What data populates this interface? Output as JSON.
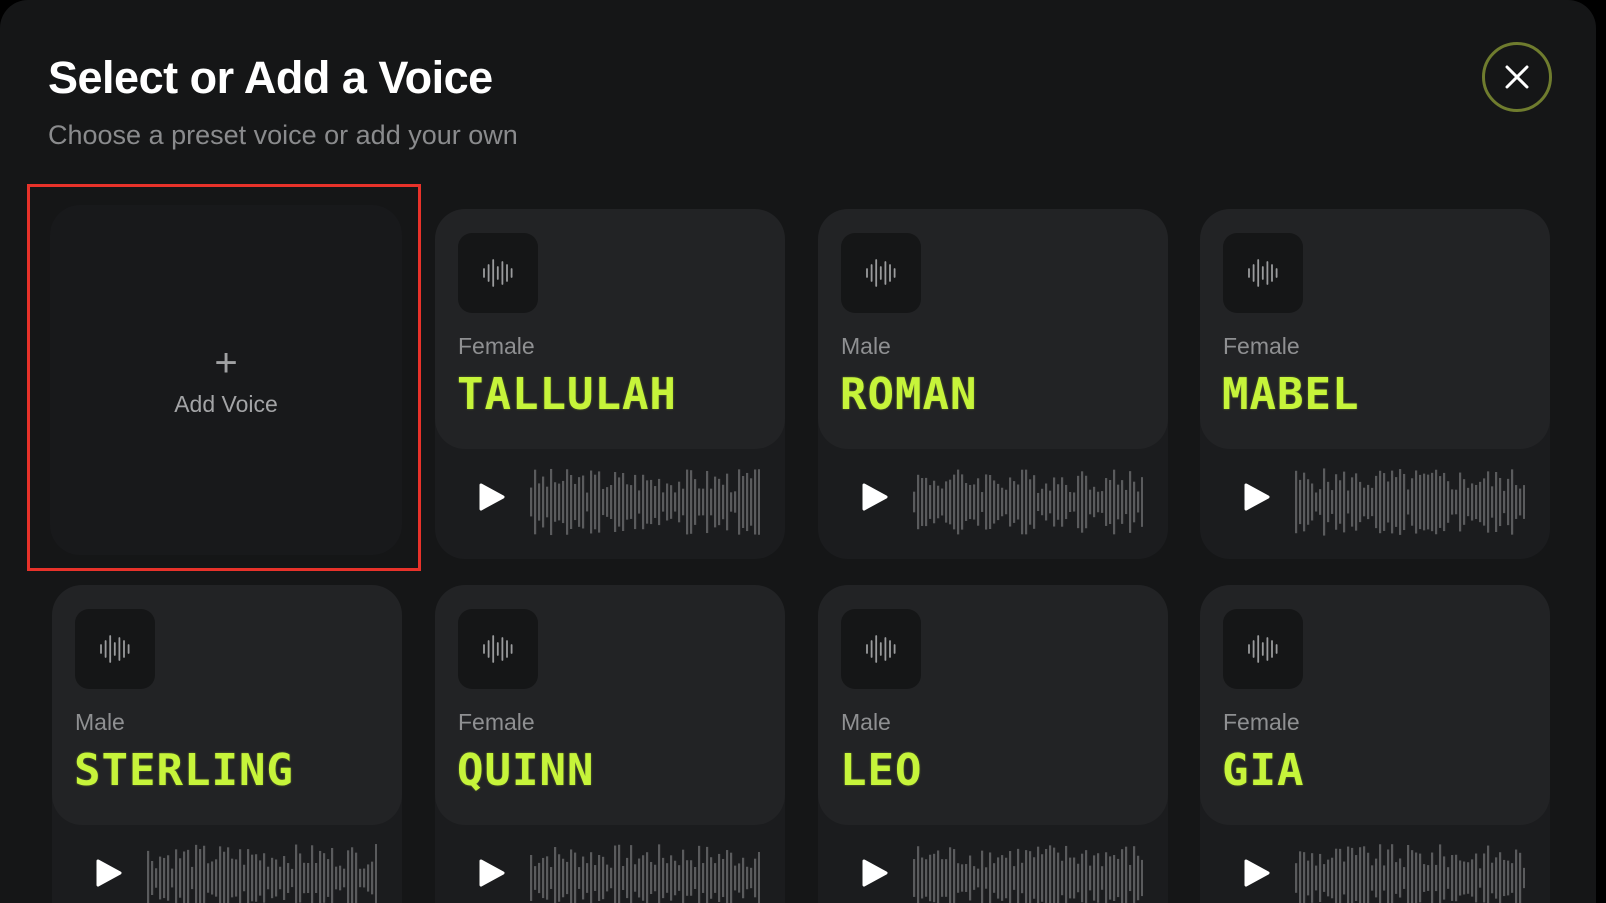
{
  "modal": {
    "title": "Select or Add a Voice",
    "subtitle": "Choose a preset voice or add your own",
    "close_icon": "close-icon"
  },
  "add_card": {
    "label": "Add Voice",
    "plus": "+",
    "icon": "plus-icon"
  },
  "colors": {
    "accent_name": "#c6f43a",
    "close_ring": "#6f7c2e",
    "highlight": "#e8322a"
  },
  "voices": [
    {
      "gender": "Female",
      "name": "TALLULAH"
    },
    {
      "gender": "Male",
      "name": "ROMAN"
    },
    {
      "gender": "Female",
      "name": "MABEL"
    },
    {
      "gender": "Male",
      "name": "STERLING"
    },
    {
      "gender": "Female",
      "name": "QUINN"
    },
    {
      "gender": "Male",
      "name": "LEO"
    },
    {
      "gender": "Female",
      "name": "GIA"
    }
  ]
}
